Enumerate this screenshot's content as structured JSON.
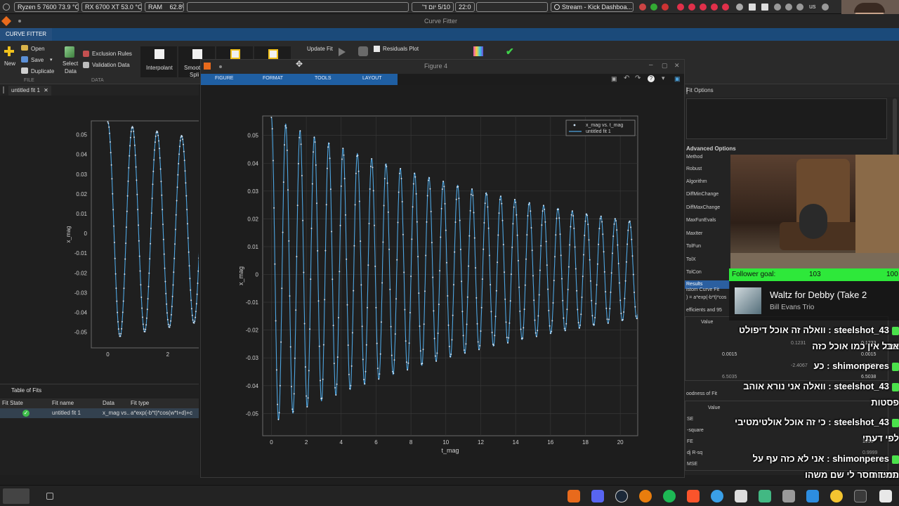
{
  "topbar": {
    "cpu": "Ryzen 5 7600  73.9 °C",
    "gpu": "RX 6700 XT  53.0 °C",
    "ram_label": "RAM",
    "ram_value": "62.8%",
    "date": "5/10 יום ד'",
    "time": "22:0",
    "window_title": "Stream - Kick Dashboa...",
    "keyboard": "us"
  },
  "titlebar": {
    "title": "Curve Fitter"
  },
  "tabstrip": {
    "tab": "CURVE FITTER"
  },
  "ribbon": {
    "new": "New",
    "open": "Open",
    "save": "Save",
    "duplicate": "Duplicate",
    "file_section": "FILE",
    "select_data": [
      "Select",
      "Data"
    ],
    "exclusion_rules": "Exclusion Rules",
    "validation_data": "Validation Data",
    "data_section": "DATA",
    "interpolant": "Interpolant",
    "smoothing_spline": [
      "Smooth",
      "Spli"
    ],
    "update_fit": "Update Fit",
    "residuals_plot": "Residuals Plot"
  },
  "doc_tab": "untitled fit 1",
  "left_plot": {
    "ylabel": "x_mag",
    "yticks": [
      "0.05",
      "0.04",
      "0.03",
      "0.02",
      "0.01",
      "0",
      "-0.01",
      "-0.02",
      "-0.03",
      "-0.04",
      "-0.05"
    ],
    "xticks": [
      "0",
      "2"
    ]
  },
  "fits_table": {
    "title": "Table of Fits",
    "columns": [
      "Fit State",
      "Fit name",
      "Data",
      "Fit type"
    ],
    "rows": [
      {
        "state": "ok",
        "name": "untitled fit 1",
        "data": "x_mag vs...",
        "type": "a*exp(-b*t)*cos(w*t+d)+c"
      }
    ]
  },
  "figure": {
    "title": "Figure 4",
    "tabs": [
      "FIGURE",
      "FORMAT",
      "TOOLS",
      "LAYOUT"
    ]
  },
  "chart_data": {
    "type": "scatter",
    "xlabel": "t_mag",
    "ylabel": "x_mag",
    "xlim": [
      -0.5,
      21
    ],
    "ylim": [
      -0.058,
      0.057
    ],
    "xticks": [
      0,
      2,
      4,
      6,
      8,
      10,
      12,
      14,
      16,
      18,
      20
    ],
    "yticks": [
      0.05,
      0.04,
      0.03,
      0.02,
      0.01,
      0,
      -0.01,
      -0.02,
      -0.03,
      -0.04,
      -0.05
    ],
    "grid": true,
    "legend_position": "top-right",
    "series": [
      {
        "name": "x_mag vs. t_mag",
        "kind": "points",
        "color": "#cfe3f5"
      },
      {
        "name": "untitled fit 1",
        "kind": "line",
        "color": "#4ea5e0"
      }
    ],
    "model": {
      "formula": "a*exp(-b*t)*cos(w*t+d)+c",
      "a": 0.055,
      "b": 0.055,
      "w": 7.65,
      "d": 0.0,
      "c": 0.0015
    }
  },
  "fit_options": {
    "title": "Fit Options",
    "advanced": "Advanced Options",
    "options": [
      "Method",
      "Robust",
      "Algorithm",
      "DiffMinChange",
      "DiffMaxChange",
      "MaxFunEvals",
      "MaxIter",
      "TolFun",
      "TolX",
      "TolCon"
    ],
    "results": "Results",
    "custom_curve": "istom Curve Fit",
    "equation": ") = a*exp(-b*t)*cos",
    "coeff_header": "efficients and 95",
    "value": "Value",
    "coeff_values": [
      [
        "0.1231",
        "0.1233"
      ],
      [
        "0.0015",
        "0.0015"
      ],
      [
        "-2.4067",
        "-2.4052"
      ],
      [
        "6.5035",
        "6.5038"
      ]
    ],
    "gof_header": "oodness of Fit",
    "gof_value": "Value",
    "gof_labels": [
      "SE",
      "-square",
      "FE",
      "dj R-sq",
      "MSE"
    ],
    "gof_values": [
      "",
      "",
      "1958",
      "0.9999",
      ""
    ]
  },
  "stream": {
    "goal_label": "Follower goal:",
    "goal_current": "103",
    "goal_target": "100",
    "goal_fraction": 1.0,
    "song_title": "Waltz for Debby (Take 2",
    "song_artist": "Bill Evans Trio",
    "chat": [
      {
        "user": "steelshot_43",
        "text": "וואלה זה אוכל דיפולט כזה"
      },
      {
        "user": "",
        "text": "אבל אין כמו אוכל כזה"
      },
      {
        "user": "shimonperes",
        "text": "כע"
      },
      {
        "user": "steelshot_43",
        "text": "וואלה אני נורא אוהב"
      },
      {
        "user": "",
        "text": "פסטות"
      },
      {
        "user": "steelshot_43",
        "text": "כי זה אוכל אולטימטיבי"
      },
      {
        "user": "",
        "text": "לפי דעתי"
      },
      {
        "user": "shimonperes",
        "text": "אני לא כזה עף על פסטות"
      },
      {
        "user": "",
        "text": "תמיד חסר לי שם משהו"
      }
    ]
  }
}
